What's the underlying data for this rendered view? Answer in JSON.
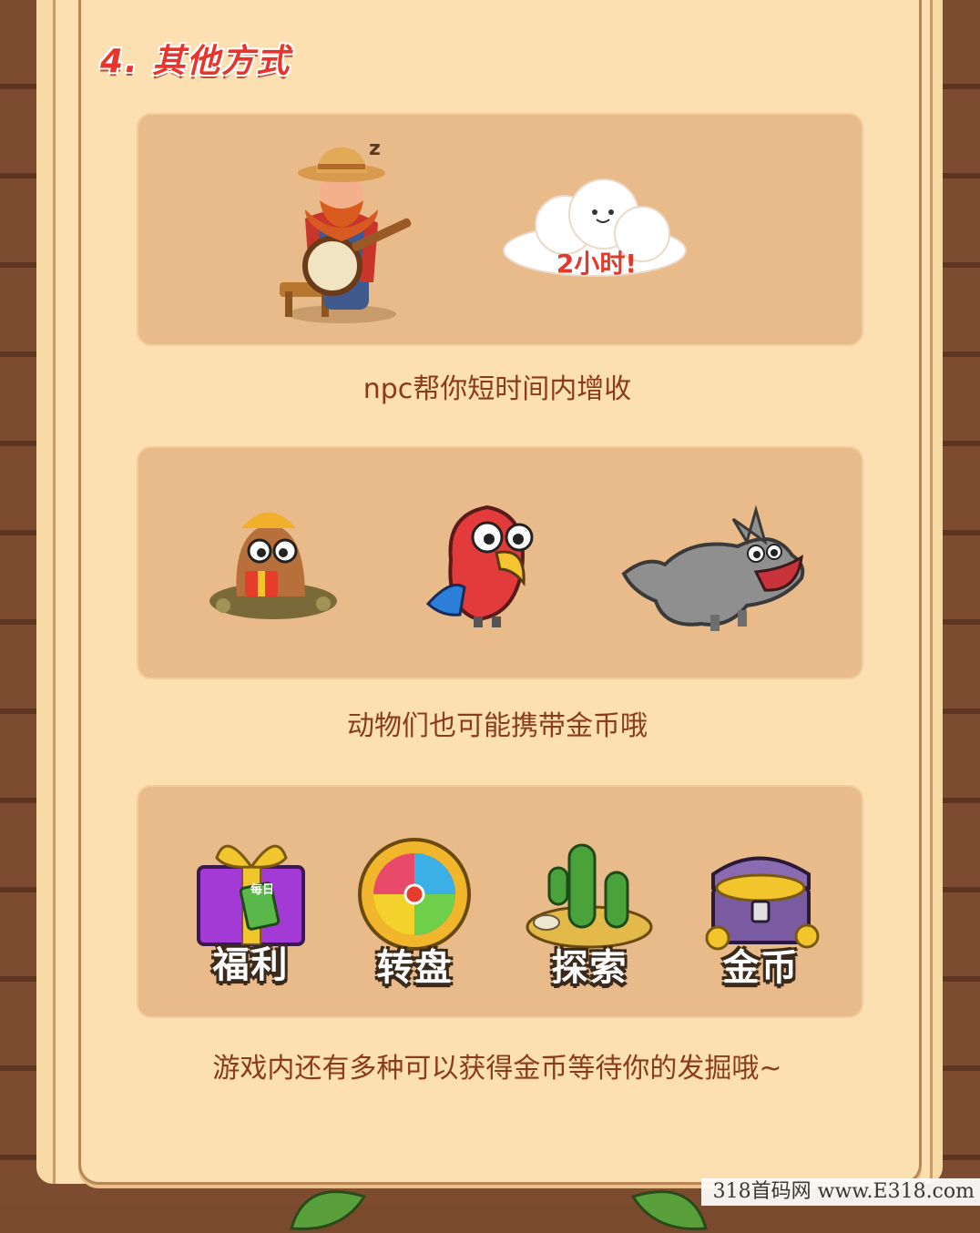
{
  "section": {
    "title": "4. 其他方式"
  },
  "cards": [
    {
      "caption": "npc帮你短时间内增收",
      "cloud_text": "2小时!"
    },
    {
      "caption": "动物们也可能携带金币哦"
    },
    {
      "caption": "游戏内还有多种可以获得金币等待你的发掘哦~",
      "tiles": [
        {
          "label": "福利",
          "icon": "gift-box-icon",
          "badge": "每日"
        },
        {
          "label": "转盘",
          "icon": "wheel-icon"
        },
        {
          "label": "探索",
          "icon": "cactus-icon"
        },
        {
          "label": "金币",
          "icon": "treasure-chest-icon"
        }
      ]
    }
  ],
  "watermark": "318首码网 www.E318.com",
  "colors": {
    "paper": "#fde0b1",
    "card": "#e9bb8a",
    "caption": "#8a3a1f",
    "title": "#e8342b"
  }
}
